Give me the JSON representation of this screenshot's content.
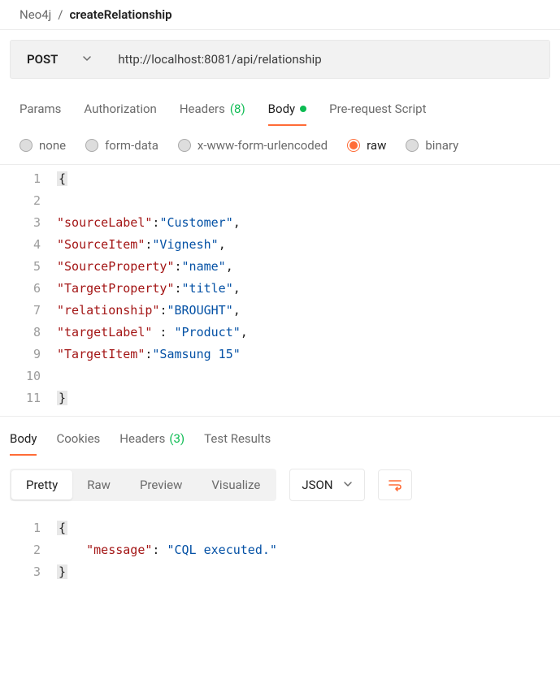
{
  "breadcrumb": {
    "collection": "Neo4j",
    "separator": "/",
    "request": "createRelationship"
  },
  "request": {
    "method": "POST",
    "url": "http://localhost:8081/api/relationship"
  },
  "tabs": {
    "params": "Params",
    "authorization": "Authorization",
    "headers": "Headers",
    "headers_count": "(8)",
    "body": "Body",
    "prerequest": "Pre-request Script"
  },
  "body_type": {
    "none": "none",
    "formdata": "form-data",
    "xwww": "x-www-form-urlencoded",
    "raw": "raw",
    "binary": "binary"
  },
  "request_body": {
    "lines": [
      {
        "n": 1,
        "type": "brace",
        "text": "{"
      },
      {
        "n": 2,
        "type": "empty"
      },
      {
        "n": 3,
        "key": "\"sourceLabel\"",
        "val": "\"Customer\"",
        "comma": true
      },
      {
        "n": 4,
        "key": "\"SourceItem\"",
        "val": "\"Vignesh\"",
        "comma": true
      },
      {
        "n": 5,
        "key": "\"SourceProperty\"",
        "val": "\"name\"",
        "comma": true
      },
      {
        "n": 6,
        "key": "\"TargetProperty\"",
        "val": "\"title\"",
        "comma": true
      },
      {
        "n": 7,
        "key": "\"relationship\"",
        "val": "\"BROUGHT\"",
        "comma": true
      },
      {
        "n": 8,
        "key": "\"targetLabel\"",
        "spaced": true,
        "val": "\"Product\"",
        "comma": true
      },
      {
        "n": 9,
        "key": "\"TargetItem\"",
        "val": "\"Samsung 15\"",
        "comma": false
      },
      {
        "n": 10,
        "type": "empty"
      },
      {
        "n": 11,
        "type": "brace",
        "text": "}"
      }
    ]
  },
  "response_tabs": {
    "body": "Body",
    "cookies": "Cookies",
    "headers": "Headers",
    "headers_count": "(3)",
    "tests": "Test Results"
  },
  "view": {
    "pretty": "Pretty",
    "raw": "Raw",
    "preview": "Preview",
    "visualize": "Visualize",
    "format": "JSON"
  },
  "response_body": {
    "lines": [
      {
        "n": 1,
        "type": "brace",
        "text": "{"
      },
      {
        "n": 2,
        "indent": 4,
        "key": "\"message\"",
        "sep": ": ",
        "val": "\"CQL executed.\""
      },
      {
        "n": 3,
        "type": "brace",
        "text": "}"
      }
    ]
  }
}
